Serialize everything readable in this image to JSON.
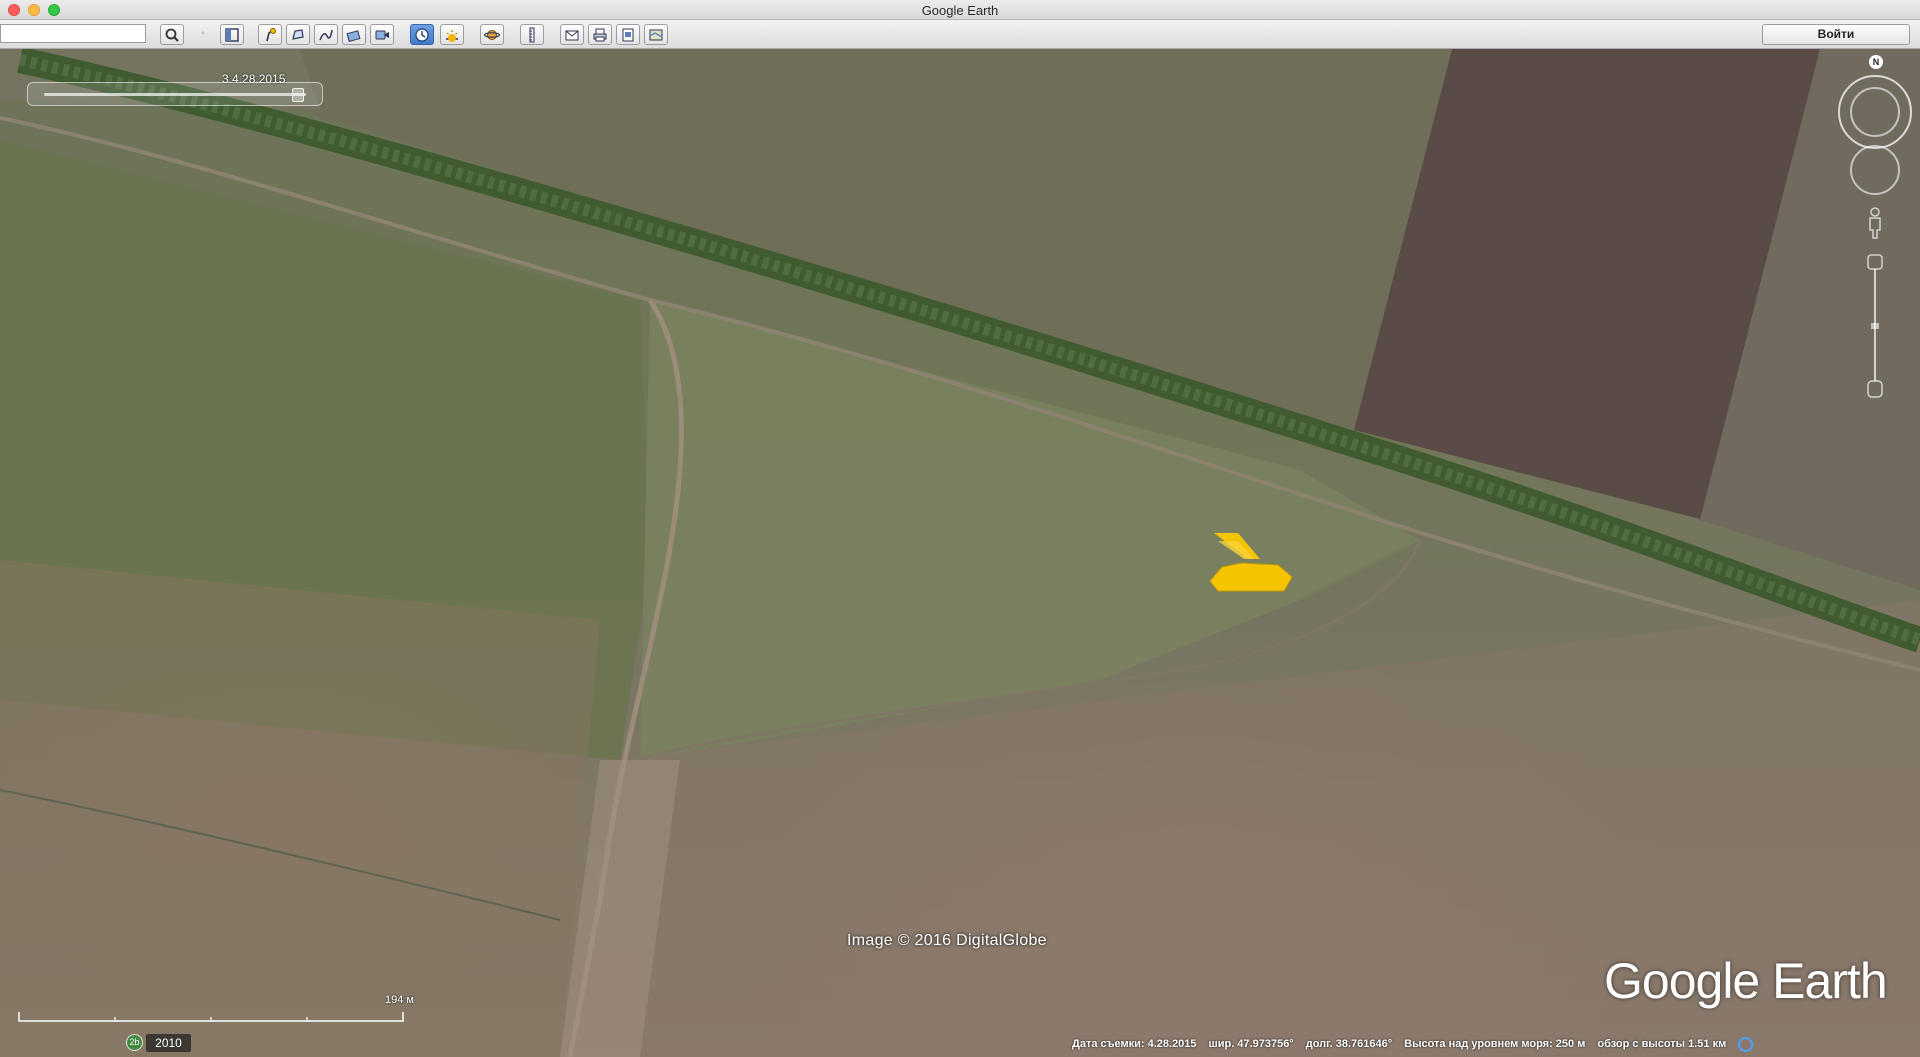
{
  "window": {
    "title": "Google Earth"
  },
  "toolbar": {
    "search_value": "",
    "search_placeholder": "",
    "signin_label": "Войти",
    "tools": [
      {
        "name": "search",
        "icon": "search-icon",
        "active": false
      },
      {
        "name": "sidebar",
        "icon": "sidebar-icon",
        "active": false
      },
      {
        "name": "placemark",
        "icon": "placemark-icon",
        "active": false
      },
      {
        "name": "polygon",
        "icon": "polygon-icon",
        "active": false
      },
      {
        "name": "path",
        "icon": "path-icon",
        "active": false
      },
      {
        "name": "overlay",
        "icon": "image-overlay-icon",
        "active": false
      },
      {
        "name": "tour",
        "icon": "record-tour-icon",
        "active": false
      },
      {
        "name": "historical",
        "icon": "historical-imagery-icon",
        "active": true
      },
      {
        "name": "sunlight",
        "icon": "sunlight-icon",
        "active": false
      },
      {
        "name": "planets",
        "icon": "planet-icon",
        "active": false
      },
      {
        "name": "ruler",
        "icon": "ruler-icon",
        "active": false
      },
      {
        "name": "email",
        "icon": "email-icon",
        "active": false
      },
      {
        "name": "print",
        "icon": "print-icon",
        "active": false
      },
      {
        "name": "save-image",
        "icon": "save-image-icon",
        "active": false
      },
      {
        "name": "maps-view",
        "icon": "maps-view-icon",
        "active": false
      }
    ]
  },
  "map": {
    "time_slider": {
      "date_label": "3.4.28.2015",
      "position": 1.0
    },
    "credit": "Image © 2016 DigitalGlobe",
    "logo": "Google Earth",
    "compass_label": "N",
    "scale_label": "194 м",
    "history_icon_label": "2b",
    "history_year": "2010",
    "marker_color": "#f5c400"
  },
  "status": {
    "date": "Дата съемки: 4.28.2015",
    "lat": "шир.   47.973756°",
    "lon": "долг.   38.761646°",
    "elev": "Высота над уровнем моря:   250 м",
    "eye": "обзор с высоты   1.51 км"
  }
}
